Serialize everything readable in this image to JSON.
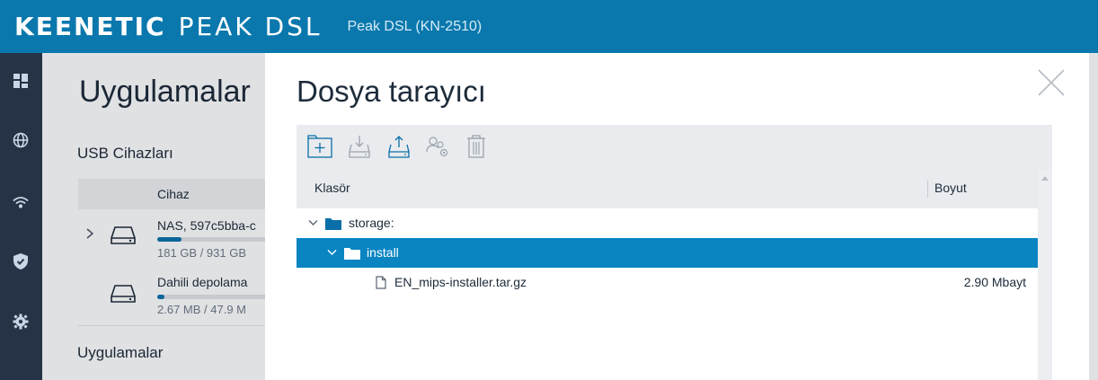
{
  "header": {
    "brand_bold": "KEENETIC",
    "brand_thin": "PEAK DSL",
    "model": "Peak DSL (KN-2510)"
  },
  "nav": {
    "icons": [
      "dashboard-icon",
      "globe-icon",
      "wifi-icon",
      "shield-icon",
      "gear-icon"
    ]
  },
  "page": {
    "title": "Uygulamalar",
    "usb_heading": "USB Cihazları",
    "device_column": "Cihaz",
    "devices": [
      {
        "name": "NAS, 597c5bba-c",
        "size": "181 GB / 931 GB",
        "usage": 0.19
      },
      {
        "name": "Dahili depolama",
        "size": "2.67 MB / 47.9 M",
        "usage": 0.06
      }
    ],
    "apps_heading": "Uygulamalar"
  },
  "modal": {
    "title": "Dosya tarayıcı",
    "toolbar": [
      "new-folder-icon",
      "download-icon",
      "upload-icon",
      "permissions-icon",
      "delete-icon"
    ],
    "columns": {
      "folder": "Klasör",
      "size": "Boyut"
    },
    "tree": {
      "root": "storage:",
      "folder": "install",
      "file": "EN_mips-installer.tar.gz",
      "file_size": "2.90 Mbayt"
    }
  },
  "colors": {
    "header_bg": "#0a78ad",
    "nav_bg": "#263346",
    "selection": "#0a85c2",
    "accent": "#0a6fa8"
  }
}
